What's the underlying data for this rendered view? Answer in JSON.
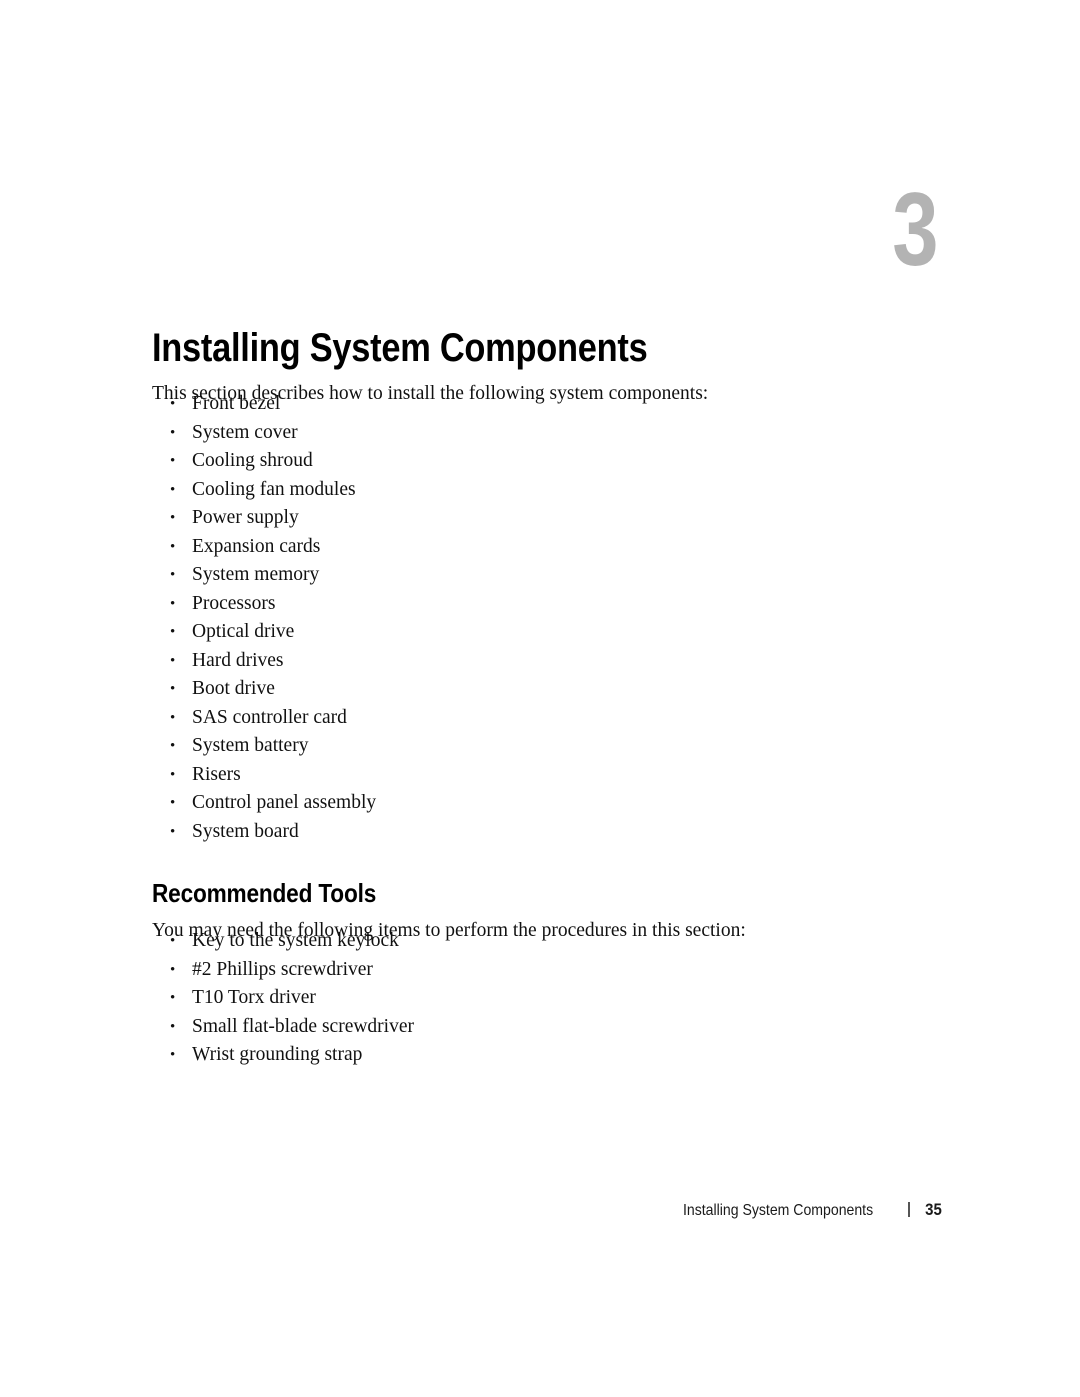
{
  "document": {
    "chapter_number": "3",
    "chapter_title": "Installing System Components"
  },
  "components_section": {
    "intro": "This section describes how to install the following system components:",
    "items": [
      "Front bezel",
      "System cover",
      "Cooling shroud",
      "Cooling fan modules",
      "Power supply",
      "Expansion cards",
      "System memory",
      "Processors",
      "Optical drive",
      "Hard drives",
      "Boot drive",
      "SAS controller card",
      "System battery",
      "Risers",
      "Control panel assembly",
      "System board"
    ]
  },
  "tools_section": {
    "heading": "Recommended Tools",
    "intro": "You may need the following items to perform the procedures in this section:",
    "items": [
      "Key to the system keylock",
      "#2 Phillips screwdriver",
      "T10 Torx driver",
      "Small flat-blade screwdriver",
      "Wrist grounding strap"
    ]
  },
  "footer": {
    "title": "Installing System Components",
    "separator": "|",
    "page_number": "35"
  },
  "colors": {
    "chapter_number_gray": "#b3b3b3",
    "text_black": "#111111",
    "page_background": "#ffffff"
  }
}
